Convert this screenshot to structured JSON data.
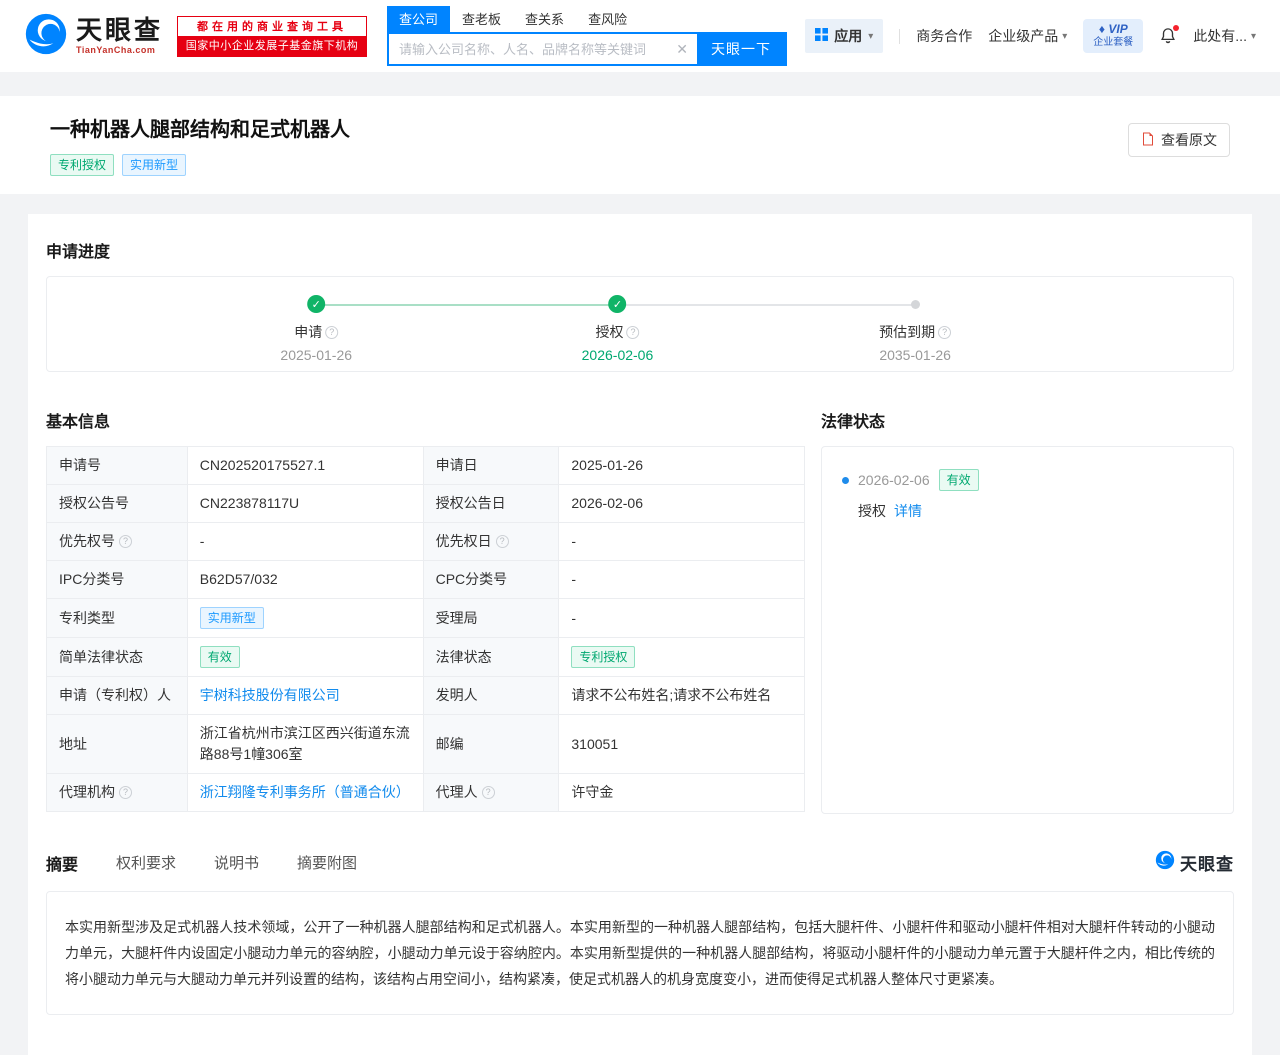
{
  "icons": {
    "check": "✓",
    "clear": "✕",
    "help": "?",
    "caret": "▾",
    "diamond": "♦"
  },
  "colors": {
    "brand_blue": "#0084ff",
    "green": "#00a870",
    "red": "#e60012",
    "link_blue": "#128bed"
  },
  "header": {
    "logo": {
      "name": "天眼查",
      "domain": "TianYanCha.com"
    },
    "promo": {
      "line1": "都在用的商业查询工具",
      "line2": "国家中小企业发展子基金旗下机构"
    },
    "search": {
      "tabs": [
        "查公司",
        "查老板",
        "查关系",
        "查风险"
      ],
      "placeholder": "请输入公司名称、人名、品牌名称等关键词",
      "button": "天眼一下"
    },
    "nav": {
      "apps": "应用",
      "cooperation": "商务合作",
      "enterprise": "企业级产品",
      "vip_line1": "VIP",
      "vip_line2": "企业套餐",
      "user": "此处有..."
    }
  },
  "title_section": {
    "title": "一种机器人腿部结构和足式机器人",
    "tag_green": "专利授权",
    "tag_blue": "实用新型",
    "view_original": "查看原文"
  },
  "progress": {
    "heading": "申请进度",
    "steps": [
      {
        "label": "申请",
        "date": "2025-01-26"
      },
      {
        "label": "授权",
        "date": "2026-02-06"
      },
      {
        "label": "预估到期",
        "date": "2035-01-26"
      }
    ]
  },
  "basic_info": {
    "heading": "基本信息",
    "rows": {
      "r1": {
        "l1": "申请号",
        "v1": "CN202520175527.1",
        "l2": "申请日",
        "v2": "2025-01-26"
      },
      "r2": {
        "l1": "授权公告号",
        "v1": "CN223878117U",
        "l2": "授权公告日",
        "v2": "2026-02-06"
      },
      "r3": {
        "l1": "优先权号",
        "v1": "-",
        "l2": "优先权日",
        "v2": "-"
      },
      "r4": {
        "l1": "IPC分类号",
        "v1": "B62D57/032",
        "l2": "CPC分类号",
        "v2": "-"
      },
      "r5": {
        "l1": "专利类型",
        "v1": "实用新型",
        "l2": "受理局",
        "v2": "-"
      },
      "r6": {
        "l1": "简单法律状态",
        "v1": "有效",
        "l2": "法律状态",
        "v2": "专利授权"
      },
      "r7": {
        "l1": "申请（专利权）人",
        "v1": "宇树科技股份有限公司",
        "l2": "发明人",
        "v2": "请求不公布姓名;请求不公布姓名"
      },
      "r8": {
        "l1": "地址",
        "v1": "浙江省杭州市滨江区西兴街道东流路88号1幢306室",
        "l2": "邮编",
        "v2": "310051"
      },
      "r9": {
        "l1": "代理机构",
        "v1": "浙江翔隆专利事务所（普通合伙）",
        "l2": "代理人",
        "v2": "许守金"
      }
    }
  },
  "legal_status": {
    "heading": "法律状态",
    "date": "2026-02-06",
    "status": "有效",
    "action": "授权",
    "detail": "详情"
  },
  "tabs": {
    "items": [
      "摘要",
      "权利要求",
      "说明书",
      "摘要附图"
    ]
  },
  "footer_brand": "天眼查",
  "abstract": {
    "text": "本实用新型涉及足式机器人技术领域，公开了一种机器人腿部结构和足式机器人。本实用新型的一种机器人腿部结构，包括大腿杆件、小腿杆件和驱动小腿杆件相对大腿杆件转动的小腿动力单元，大腿杆件内设固定小腿动力单元的容纳腔，小腿动力单元设于容纳腔内。本实用新型提供的一种机器人腿部结构，将驱动小腿杆件的小腿动力单元置于大腿杆件之内，相比传统的将小腿动力单元与大腿动力单元并列设置的结构，该结构占用空间小，结构紧凑，使足式机器人的机身宽度变小，进而使得足式机器人整体尺寸更紧凑。"
  }
}
